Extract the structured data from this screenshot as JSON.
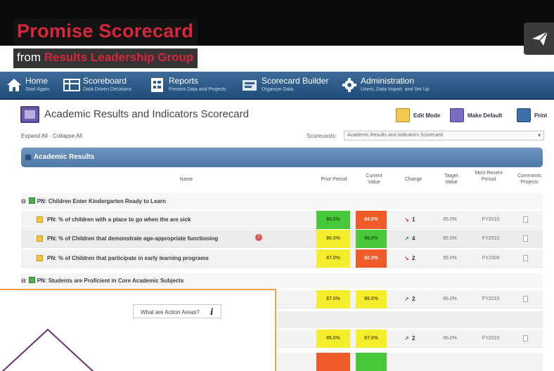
{
  "video": {
    "title": "Promise Scorecard",
    "from_label": "from",
    "org": "Results Leadership Group",
    "share_icon": "paper-plane-icon"
  },
  "nav": [
    {
      "label": "Home",
      "sub": "Start Again",
      "icon": "home-icon"
    },
    {
      "label": "Scoreboard",
      "sub": "Data Driven Decisions",
      "icon": "scoreboard-icon"
    },
    {
      "label": "Reports",
      "sub": "Present Data and Projects",
      "icon": "reports-icon"
    },
    {
      "label": "Scorecard Builder",
      "sub": "Organize Data",
      "icon": "builder-icon"
    },
    {
      "label": "Administration",
      "sub": "Users, Data Import, and Set Up",
      "icon": "gear-icon"
    }
  ],
  "page": {
    "title": "Academic Results and Indicators Scorecard",
    "tools": {
      "edit": "Edit Mode",
      "default": "Make Default",
      "print": "Print"
    },
    "expand": "Expand All",
    "collapse": "Collapse All",
    "scorecards_label": "Scorecards:",
    "scorecards_value": "Academic Results and Indicators Scorecard"
  },
  "section": {
    "title": "Academic Results"
  },
  "columns": {
    "name": "Name",
    "prior": "Prior Period",
    "current": "Current Value",
    "change": "Change",
    "target": "Target Value",
    "recent": "Most Recent Period",
    "comments": "Comments Projects"
  },
  "groups": [
    {
      "label": "PN: Children Enter Kindergarten Ready to Learn"
    },
    {
      "label": "PN: Students are Proficient in Core Academic Subjects"
    }
  ],
  "rows": [
    {
      "name": "PN: % of children with a place to go when the are sick",
      "prior": "96.0%",
      "prior_color": "green",
      "current": "84.0%",
      "current_color": "red",
      "change_dir": "down",
      "change": "1",
      "target": "95.0%",
      "recent": "FY2010"
    },
    {
      "name": "PN: % of Children that demonstrate age-appropriate functioning",
      "prior": "86.0%",
      "prior_color": "yellow",
      "current": "96.0%",
      "current_color": "green",
      "change_dir": "up",
      "change": "4",
      "target": "95.0%",
      "recent": "FY2010"
    },
    {
      "name": "PN: % of Children that participate in early learning programs",
      "prior": "87.0%",
      "prior_color": "yellow",
      "current": "82.0%",
      "current_color": "red",
      "change_dir": "down",
      "change": "2",
      "target": "95.0%",
      "recent": "FY2009"
    },
    {
      "name": "",
      "prior": "87.0%",
      "prior_color": "yellow",
      "current": "88.0%",
      "current_color": "yellow",
      "change_dir": "up",
      "change": "2",
      "target": "95.0%",
      "recent": "FY2010"
    },
    {
      "name": "",
      "prior": "85.0%",
      "prior_color": "yellow",
      "current": "87.0%",
      "current_color": "yellow",
      "change_dir": "up",
      "change": "2",
      "target": "95.0%",
      "recent": "FY2010"
    }
  ],
  "overlay": {
    "action_areas": "What are Action Areas?",
    "info_icon": "info-icon"
  }
}
